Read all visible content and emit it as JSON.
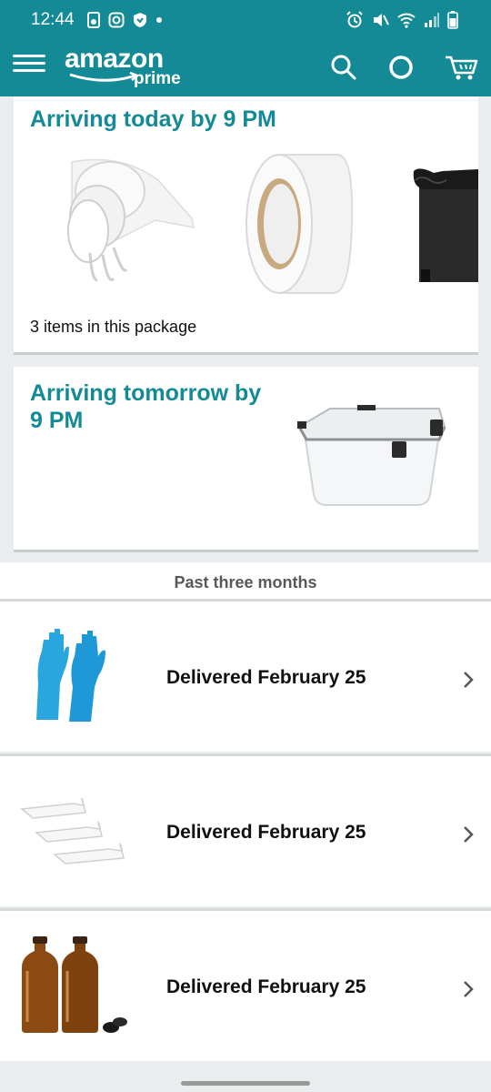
{
  "status_bar": {
    "time": "12:44"
  },
  "header": {
    "logo_word": "amazon",
    "logo_sub": "prime"
  },
  "packages": [
    {
      "title_line1": "Arriving today by 9 PM",
      "title_line2": "",
      "count_text": "3 items in this package"
    },
    {
      "title_line1": "Arriving tomorrow by",
      "title_line2": "9 PM"
    }
  ],
  "history": {
    "heading": "Past three months",
    "orders": [
      {
        "status": "Delivered February 25",
        "icon": "gloves"
      },
      {
        "status": "Delivered February 25",
        "icon": "shelves"
      },
      {
        "status": "Delivered February 25",
        "icon": "amber-bottles"
      }
    ]
  },
  "colors": {
    "brand": "#138a96",
    "background": "#eaeded"
  }
}
